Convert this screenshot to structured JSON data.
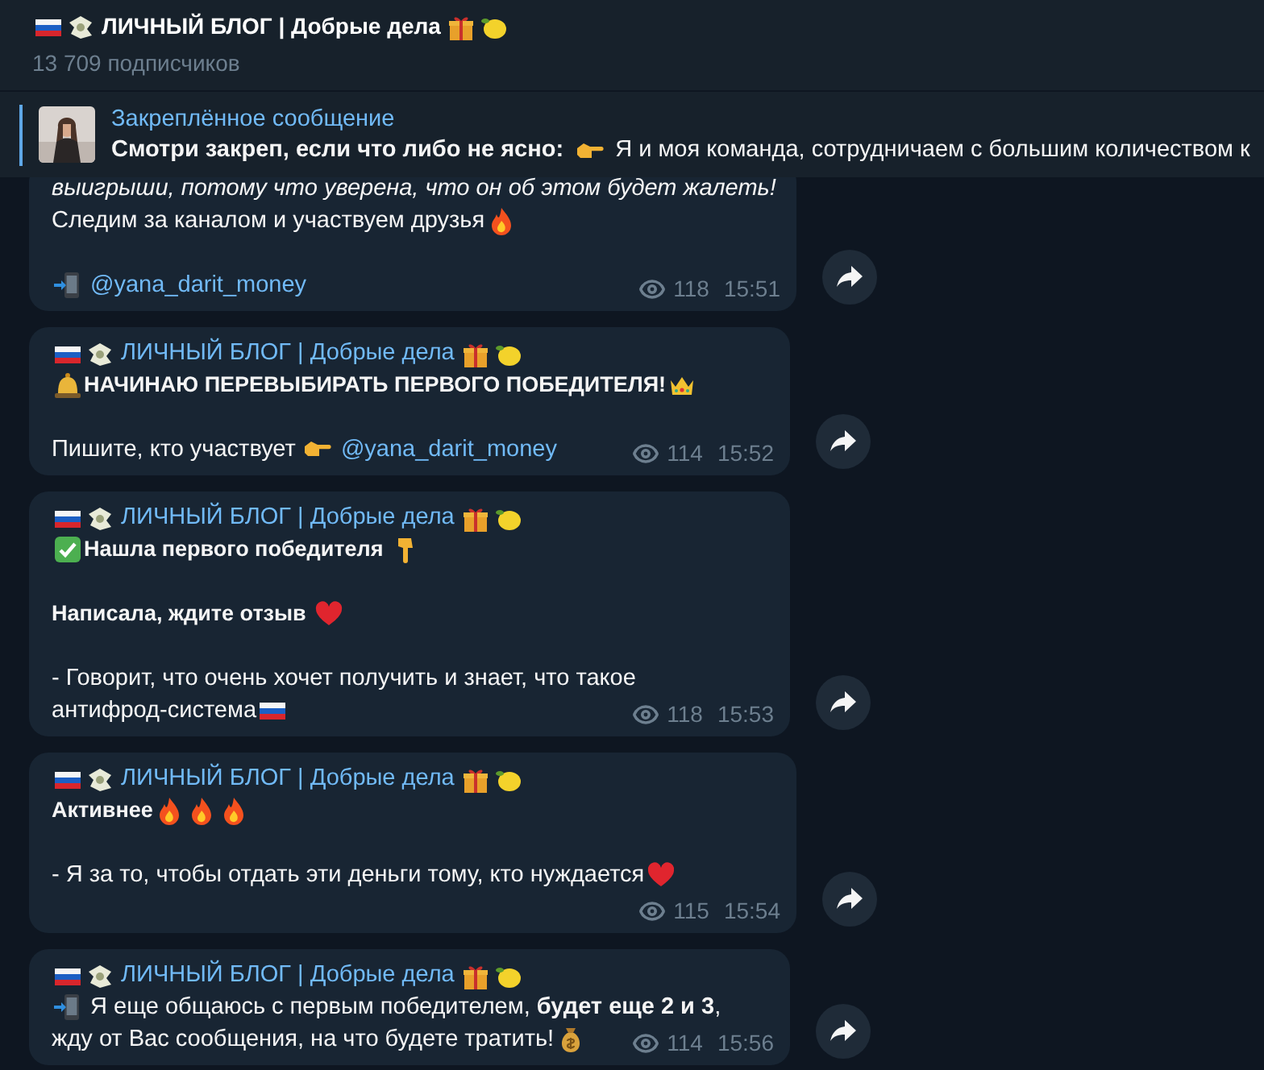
{
  "channel": {
    "title": "ЛИЧНЫЙ БЛОГ | Добрые дела",
    "subscribers": "13 709 подписчиков"
  },
  "pinned": {
    "label": "Закреплённое сообщение",
    "lead": "Смотри закреп, если что либо не ясно:",
    "text": "Я и моя команда, сотрудничаем с большим количеством к"
  },
  "messages": [
    {
      "lines": [
        {
          "kind": "line",
          "segments": [
            {
              "kind": "text",
              "text": "выигрыши, потому что уверена, что он об этом будет жалеть!",
              "italic": true
            }
          ]
        },
        {
          "kind": "line",
          "segments": [
            {
              "kind": "text",
              "text": "Следим за каналом и участвуем друзья"
            },
            {
              "kind": "fire"
            }
          ]
        },
        {
          "kind": "blank"
        },
        {
          "kind": "line",
          "segments": [
            {
              "kind": "phone"
            },
            {
              "kind": "link",
              "text": " @yana_darit_money"
            }
          ]
        }
      ],
      "views": "118",
      "time": "15:51"
    },
    {
      "author": "ЛИЧНЫЙ БЛОГ | Добрые дела",
      "lines": [
        {
          "kind": "line",
          "segments": [
            {
              "kind": "bell"
            },
            {
              "kind": "text",
              "text": "НАЧИНАЮ ПЕРЕВЫБИРАТЬ ПЕРВОГО ПОБЕДИТЕЛЯ!",
              "bold": true
            },
            {
              "kind": "crown"
            }
          ]
        },
        {
          "kind": "blank"
        },
        {
          "kind": "line",
          "segments": [
            {
              "kind": "text",
              "text": "Пишите, кто участвует "
            },
            {
              "kind": "point-right"
            },
            {
              "kind": "link",
              "text": " @yana_darit_money"
            }
          ]
        }
      ],
      "views": "114",
      "time": "15:52"
    },
    {
      "author": "ЛИЧНЫЙ БЛОГ | Добрые дела",
      "lines": [
        {
          "kind": "line",
          "segments": [
            {
              "kind": "check"
            },
            {
              "kind": "text",
              "text": "Нашла первого победителя ",
              "bold": true
            },
            {
              "kind": "point-down"
            }
          ]
        },
        {
          "kind": "blank"
        },
        {
          "kind": "line",
          "segments": [
            {
              "kind": "text",
              "text": "Написала, ждите отзыв ",
              "bold": true
            },
            {
              "kind": "heart"
            }
          ]
        },
        {
          "kind": "blank"
        },
        {
          "kind": "line",
          "segments": [
            {
              "kind": "text",
              "text": "- Говорит, что очень хочет получить и знает, что такое"
            }
          ]
        },
        {
          "kind": "line",
          "segments": [
            {
              "kind": "text",
              "text": "антифрод-система"
            },
            {
              "kind": "flag"
            }
          ]
        }
      ],
      "views": "118",
      "time": "15:53"
    },
    {
      "author": "ЛИЧНЫЙ БЛОГ | Добрые дела",
      "lines": [
        {
          "kind": "line",
          "segments": [
            {
              "kind": "text",
              "text": "Активнее",
              "bold": true
            },
            {
              "kind": "fire"
            },
            {
              "kind": "fire"
            },
            {
              "kind": "fire"
            }
          ]
        },
        {
          "kind": "blank"
        },
        {
          "kind": "line",
          "segments": [
            {
              "kind": "text",
              "text": "- Я за то, чтобы отдать эти деньги тому, кто нуждается"
            },
            {
              "kind": "heart"
            }
          ]
        }
      ],
      "views": "115",
      "time": "15:54"
    },
    {
      "author": "ЛИЧНЫЙ БЛОГ | Добрые дела",
      "lines": [
        {
          "kind": "line",
          "segments": [
            {
              "kind": "phone"
            },
            {
              "kind": "text",
              "text": " Я еще общаюсь с первым победителем, **будет еще 2 и 3**,"
            }
          ]
        },
        {
          "kind": "line",
          "segments": [
            {
              "kind": "text",
              "text": "жду от Вас сообщения, на что будете тратить!"
            },
            {
              "kind": "money-bag"
            }
          ]
        }
      ],
      "views": "114",
      "time": "15:56"
    }
  ]
}
